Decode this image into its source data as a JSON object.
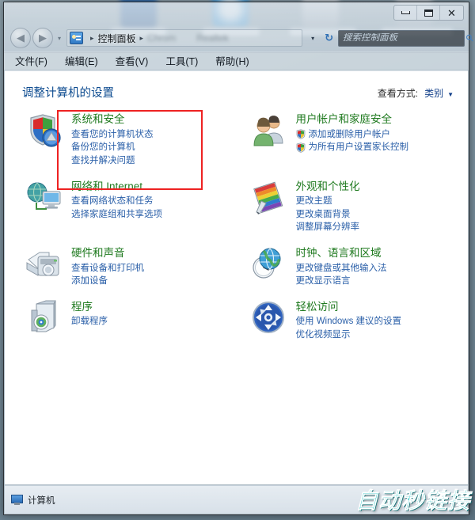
{
  "window": {
    "titlebar": {
      "minimize_label": "最小化",
      "maximize_label": "最大化",
      "close_label": "关闭"
    },
    "address": {
      "back_glyph": "◀",
      "forward_glyph": "▶",
      "recent_caret": "▾",
      "icon_name": "control-panel-icon",
      "crumb_current": "控制面板",
      "crumb_sep": "▸",
      "crumb_ghost_1": "Chrom",
      "crumb_ghost_2": "Realtek",
      "history_caret": "▾",
      "refresh_glyph": "↻"
    },
    "search": {
      "placeholder": "搜索控制面板",
      "value": "",
      "icon": "search-icon"
    },
    "menu": [
      {
        "label": "文件(F)"
      },
      {
        "label": "编辑(E)"
      },
      {
        "label": "查看(V)"
      },
      {
        "label": "工具(T)"
      },
      {
        "label": "帮助(H)"
      }
    ]
  },
  "main": {
    "page_title": "调整计算机的设置",
    "view_by": {
      "label": "查看方式:",
      "value": "类别",
      "caret": "▼"
    },
    "highlight_color": "#ee2222",
    "categories": [
      {
        "id": "system-and-security",
        "icon": "shield-icon",
        "title": "系统和安全",
        "links": [
          {
            "text": "查看您的计算机状态",
            "shield": false
          },
          {
            "text": "备份您的计算机",
            "shield": false
          },
          {
            "text": "查找并解决问题",
            "shield": false
          }
        ]
      },
      {
        "id": "user-accounts-and-family-safety",
        "icon": "users-icon",
        "title": "用户帐户和家庭安全",
        "links": [
          {
            "text": "添加或删除用户帐户",
            "shield": true
          },
          {
            "text": "为所有用户设置家长控制",
            "shield": true
          }
        ]
      },
      {
        "id": "network-and-internet",
        "icon": "network-icon",
        "title": "网络和 Internet",
        "links": [
          {
            "text": "查看网络状态和任务",
            "shield": false
          },
          {
            "text": "选择家庭组和共享选项",
            "shield": false
          }
        ]
      },
      {
        "id": "appearance-and-personalization",
        "icon": "palette-icon",
        "title": "外观和个性化",
        "links": [
          {
            "text": "更改主题",
            "shield": false
          },
          {
            "text": "更改桌面背景",
            "shield": false
          },
          {
            "text": "调整屏幕分辨率",
            "shield": false
          }
        ]
      },
      {
        "id": "hardware-and-sound",
        "icon": "printer-icon",
        "title": "硬件和声音",
        "links": [
          {
            "text": "查看设备和打印机",
            "shield": false
          },
          {
            "text": "添加设备",
            "shield": false
          }
        ]
      },
      {
        "id": "clock-language-and-region",
        "icon": "clock-globe-icon",
        "title": "时钟、语言和区域",
        "links": [
          {
            "text": "更改键盘或其他输入法",
            "shield": false
          },
          {
            "text": "更改显示语言",
            "shield": false
          }
        ]
      },
      {
        "id": "programs",
        "icon": "programs-icon",
        "title": "程序",
        "links": [
          {
            "text": "卸载程序",
            "shield": false
          }
        ]
      },
      {
        "id": "ease-of-access",
        "icon": "ease-of-access-icon",
        "title": "轻松访问",
        "links": [
          {
            "text": "使用 Windows 建议的设置",
            "shield": false
          },
          {
            "text": "优化视频显示",
            "shield": false
          }
        ]
      }
    ]
  },
  "statusbar": {
    "icon": "computer-icon",
    "text": "计算机"
  },
  "watermark": {
    "text": "自动秒链接",
    "color": "#1fc4c4"
  }
}
